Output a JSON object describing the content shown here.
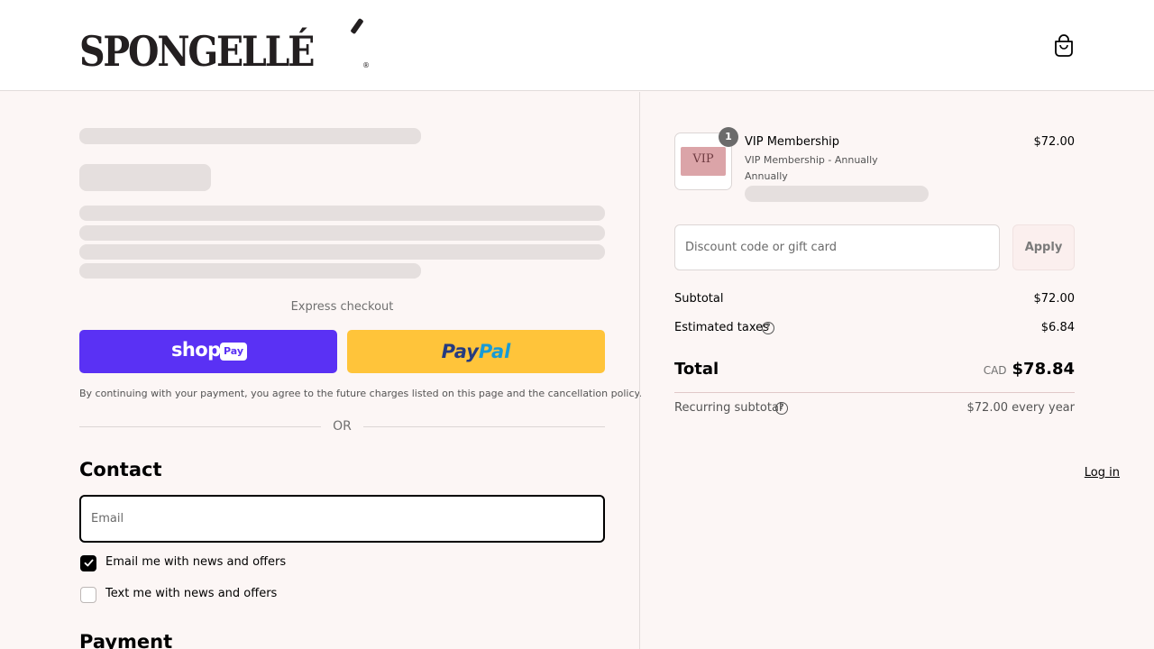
{
  "header": {
    "brand": "SPONGELLÉ",
    "brand_mark": "®",
    "cart_icon": "shopping-bag-icon"
  },
  "express": {
    "label": "Express checkout",
    "shop_pay": {
      "word": "shop",
      "badge": "Pay",
      "color": "#5a31f4"
    },
    "paypal": {
      "part1": "Pay",
      "part2": "Pal",
      "color": "#ffc43a"
    },
    "consent": "By continuing with your payment, you agree to the future charges listed on this page and the cancellation policy.",
    "or": "OR"
  },
  "contact": {
    "heading": "Contact",
    "login": "Log in",
    "email_placeholder": "Email",
    "email_value": "",
    "news_email": {
      "label": "Email me with news and offers",
      "checked": true
    },
    "news_text": {
      "label": "Text me with news and offers",
      "checked": false
    }
  },
  "payment": {
    "heading": "Payment"
  },
  "summary": {
    "item": {
      "quantity": "1",
      "image_text": "VIP",
      "title": "VIP Membership",
      "variant": "VIP Membership - Annually",
      "frequency": "Annually",
      "price": "$72.00"
    },
    "discount": {
      "placeholder": "Discount code or gift card",
      "value": "",
      "apply": "Apply"
    },
    "subtotal": {
      "label": "Subtotal",
      "value": "$72.00"
    },
    "taxes": {
      "label": "Estimated taxes",
      "value": "$6.84"
    },
    "total": {
      "label": "Total",
      "currency": "CAD",
      "value": "$78.84"
    },
    "recurring": {
      "label": "Recurring subtotal",
      "value": "$72.00 every year"
    },
    "help_icon": "?"
  }
}
